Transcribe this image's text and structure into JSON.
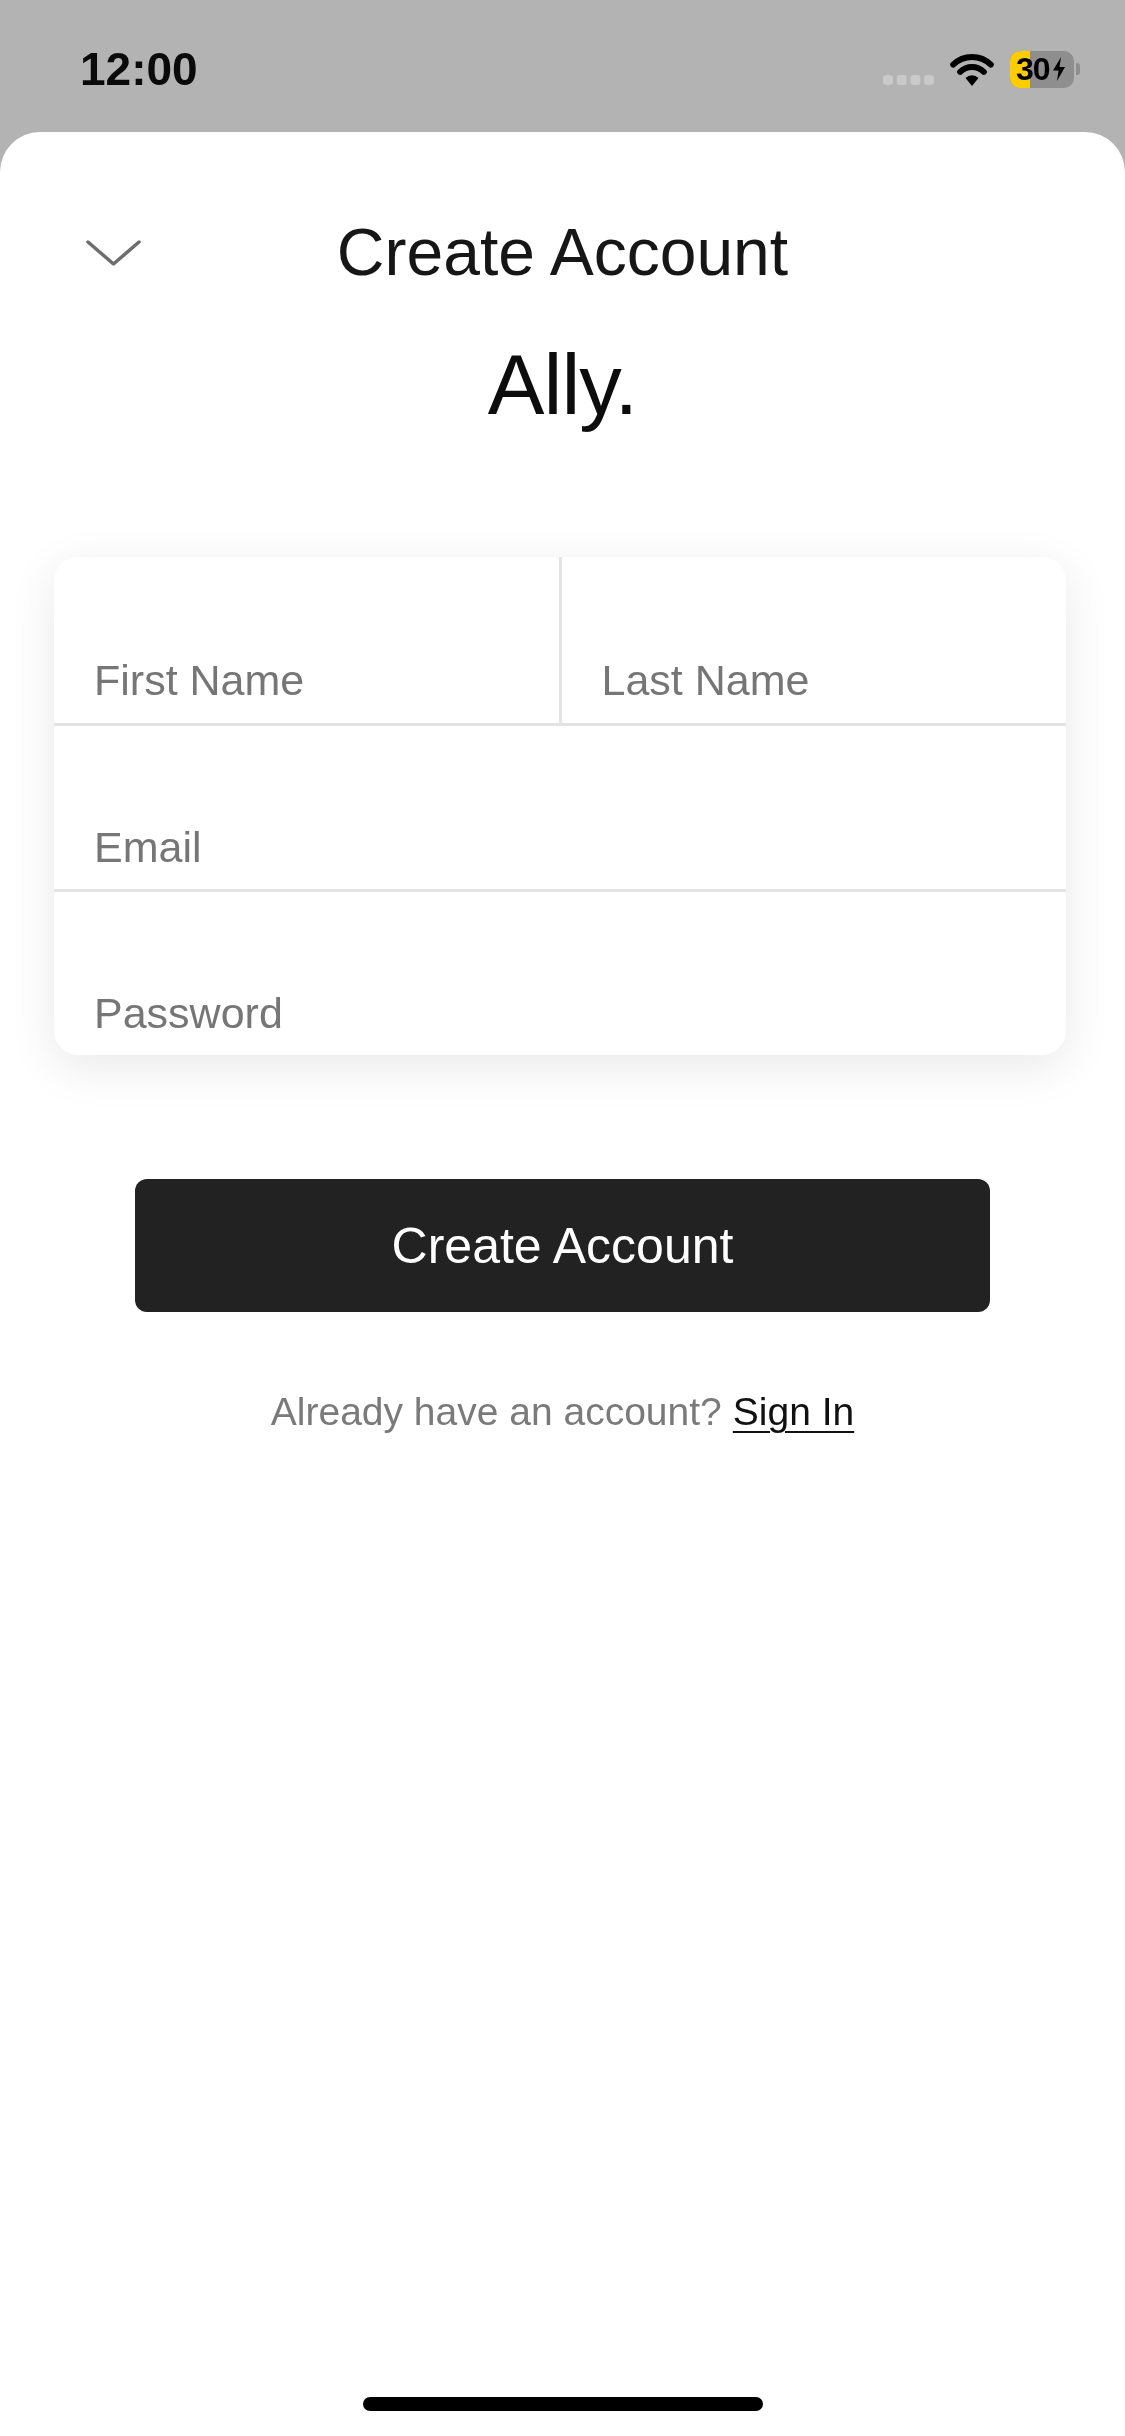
{
  "status_bar": {
    "time": "12:00",
    "battery": "30"
  },
  "header": {
    "title": "Create Account",
    "logo": "Ally."
  },
  "form": {
    "rows": [
      {
        "fields": [
          {
            "placeholder": "First Name"
          },
          {
            "placeholder": "Last Name"
          }
        ]
      },
      {
        "fields": [
          {
            "placeholder": "Email"
          }
        ]
      },
      {
        "fields": [
          {
            "placeholder": "Password"
          }
        ]
      }
    ]
  },
  "submit_button": "Create Account",
  "sign_in_prompt": {
    "text": "Already have an account?",
    "link": "Sign In"
  }
}
